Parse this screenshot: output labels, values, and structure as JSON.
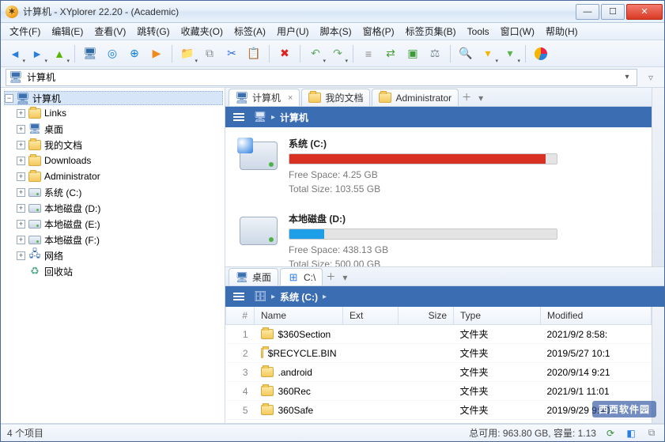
{
  "window": {
    "title": "计算机 - XYplorer 22.20 - (Academic)",
    "buttons": {
      "min": "—",
      "max": "☐",
      "close": "✕"
    }
  },
  "menu": [
    "文件(F)",
    "编辑(E)",
    "查看(V)",
    "跳转(G)",
    "收藏夹(O)",
    "标签(A)",
    "用户(U)",
    "脚本(S)",
    "窗格(P)",
    "标签页集(B)",
    "Tools",
    "窗口(W)",
    "帮助(H)"
  ],
  "toolbar_icons": [
    "back",
    "forward",
    "up",
    "sep",
    "desktop",
    "target",
    "zoom",
    "play",
    "sep",
    "new-folder",
    "copy",
    "cut",
    "paste",
    "sep",
    "delete",
    "sep",
    "undo",
    "redo",
    "sep",
    "filter",
    "sync",
    "shield",
    "weight",
    "sep",
    "find",
    "funnel",
    "funnel2",
    "sep",
    "pie"
  ],
  "address": {
    "icon": "computer",
    "value": "计算机"
  },
  "tree": {
    "root": {
      "label": "计算机",
      "children": [
        {
          "label": "Links",
          "icon": "folder",
          "exp": "+"
        },
        {
          "label": "桌面",
          "icon": "desktop",
          "exp": "+"
        },
        {
          "label": "我的文档",
          "icon": "folder",
          "exp": "+"
        },
        {
          "label": "Downloads",
          "icon": "folder",
          "exp": "+"
        },
        {
          "label": "Administrator",
          "icon": "folder",
          "exp": "+"
        },
        {
          "label": "系统 (C:)",
          "icon": "drive",
          "exp": "+"
        },
        {
          "label": "本地磁盘 (D:)",
          "icon": "drive",
          "exp": "+"
        },
        {
          "label": "本地磁盘 (E:)",
          "icon": "drive",
          "exp": "+"
        },
        {
          "label": "本地磁盘 (F:)",
          "icon": "drive",
          "exp": "+"
        },
        {
          "label": "网络",
          "icon": "network",
          "exp": "+"
        },
        {
          "label": "回收站",
          "icon": "recycle",
          "exp": ""
        }
      ]
    }
  },
  "pane_top": {
    "tabs": [
      {
        "label": "计算机",
        "icon": "computer",
        "active": true,
        "closable": true
      },
      {
        "label": "我的文档",
        "icon": "folder",
        "active": false,
        "closable": false
      },
      {
        "label": "Administrator",
        "icon": "folder",
        "active": false,
        "closable": false
      }
    ],
    "crumb": [
      "计算机"
    ],
    "drives": [
      {
        "name": "系统 (C:)",
        "free_label": "Free Space: 4.25 GB",
        "total_label": "Total Size: 103.55 GB",
        "fill_pct": 96,
        "fill_color": "#d93024",
        "sys": true
      },
      {
        "name": "本地磁盘 (D:)",
        "free_label": "Free Space: 438.13 GB",
        "total_label": "Total Size: 500.00 GB",
        "fill_pct": 13,
        "fill_color": "#1e9fe8",
        "sys": false
      }
    ]
  },
  "pane_bottom": {
    "tabs": [
      {
        "label": "桌面",
        "icon": "desktop",
        "active": false
      },
      {
        "label": "C:\\",
        "icon": "windows",
        "active": true
      }
    ],
    "crumb": [
      "系统 (C:)"
    ],
    "columns": {
      "num": "#",
      "name": "Name",
      "ext": "Ext",
      "size": "Size",
      "type": "Type",
      "mod": "Modified"
    },
    "rows": [
      {
        "n": 1,
        "name": "$360Section",
        "ext": "",
        "size": "",
        "type": "文件夹",
        "mod": "2021/9/2 8:58:"
      },
      {
        "n": 2,
        "name": "$RECYCLE.BIN",
        "ext": "",
        "size": "",
        "type": "文件夹",
        "mod": "2019/5/27 10:1"
      },
      {
        "n": 3,
        "name": ".android",
        "ext": "",
        "size": "",
        "type": "文件夹",
        "mod": "2020/9/14 9:21"
      },
      {
        "n": 4,
        "name": "360Rec",
        "ext": "",
        "size": "",
        "type": "文件夹",
        "mod": "2021/9/1 11:01"
      },
      {
        "n": 5,
        "name": "360Safe",
        "ext": "",
        "size": "",
        "type": "文件夹",
        "mod": "2019/9/29 9:40"
      }
    ]
  },
  "status": {
    "left": "4 个项目",
    "right": "总可用: 963.80 GB, 容量: 1.13"
  },
  "watermark": "西西软件园"
}
